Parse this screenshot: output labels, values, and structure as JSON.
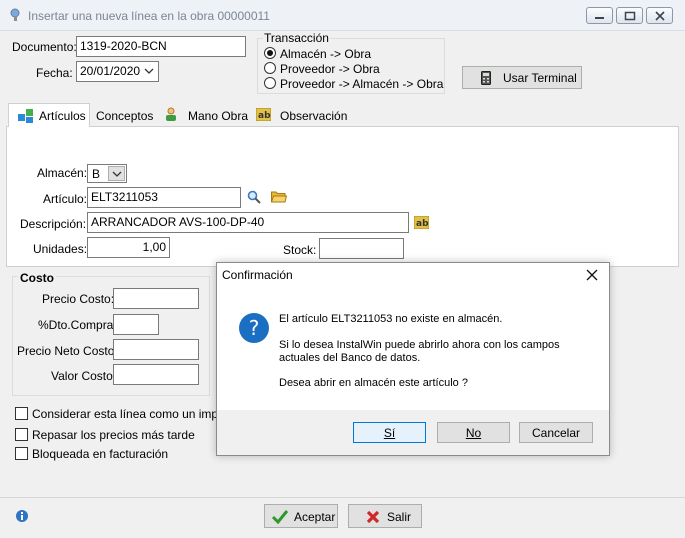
{
  "window": {
    "title": "Insertar una nueva línea en la obra 00000011"
  },
  "form": {
    "documento_label": "Documento:",
    "documento_value": "1319-2020-BCN",
    "fecha_label": "Fecha:",
    "fecha_value": "20/01/2020",
    "transaccion_title": "Transacción",
    "transaccion_options": [
      "Almacén -> Obra",
      "Proveedor -> Obra",
      "Proveedor -> Almacén -> Obra"
    ],
    "transaccion_selected": 0,
    "usar_terminal_label": "Usar Terminal"
  },
  "tabs": [
    {
      "label": "Artículos",
      "icon": "articles-icon",
      "active": true
    },
    {
      "label": "Conceptos",
      "icon": "",
      "active": false
    },
    {
      "label": "Mano Obra",
      "icon": "worker-icon",
      "active": false
    },
    {
      "label": "Observación",
      "icon": "text-ab-icon",
      "active": false
    }
  ],
  "articulos": {
    "almacen_label": "Almacén:",
    "almacen_value": "B",
    "articulo_label": "Artículo:",
    "articulo_value": "ELT3211053",
    "descripcion_label": "Descripción:",
    "descripcion_value": "ARRANCADOR AVS-100-DP-40",
    "unidades_label": "Unidades:",
    "unidades_value": "1,00",
    "stock_label": "Stock:",
    "stock_value": ""
  },
  "costo": {
    "title": "Costo",
    "precio_costo_label": "Precio Costo:",
    "dto_compra_label": "%Dto.Compra:",
    "precio_neto_label": "Precio Neto Costo:",
    "valor_costo_label": "Valor Costo"
  },
  "checkboxes": [
    {
      "label": "Considerar esta línea como un imprevis",
      "checked": false
    },
    {
      "label": "Repasar los precios más tarde",
      "checked": false
    },
    {
      "label": "Bloqueada en facturación",
      "checked": false
    }
  ],
  "footer": {
    "aceptar_label": "Aceptar",
    "salir_label": "Salir"
  },
  "dialog": {
    "title": "Confirmación",
    "line1": "El artículo ELT3211053 no existe en almacén.",
    "line2": "Si lo desea InstalWin puede abrirlo ahora con los campos",
    "line3": "actuales del Banco de datos.",
    "line4": "Desea abrir en almacén este artículo ?",
    "yes_label": "Sí",
    "no_label": "No",
    "cancel_label": "Cancelar"
  },
  "colors": {
    "accent": "#0078d7",
    "question_icon": "#1a6fc2"
  }
}
